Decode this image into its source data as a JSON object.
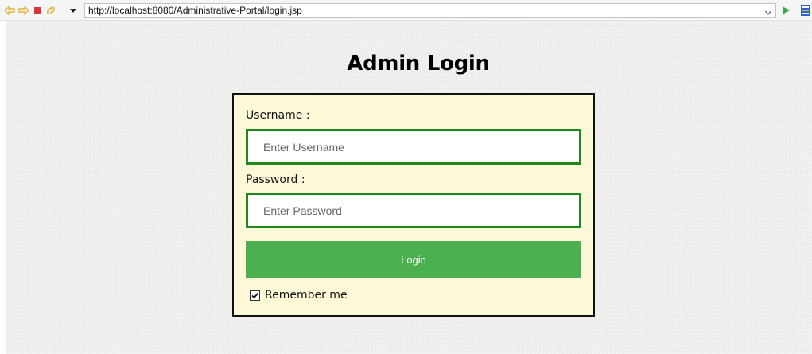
{
  "browser": {
    "url": "http://localhost:8080/Administrative-Portal/login.jsp",
    "icons": [
      "back-arrow-icon",
      "forward-arrow-icon",
      "stop-icon",
      "refresh-icon",
      "chevron-down-icon",
      "go-icon",
      "sidebar-icon"
    ],
    "colors": {
      "nav_arrow": "#e8b33a",
      "stop": "#d9323a",
      "go": "#3aa84a"
    }
  },
  "page": {
    "title": "Admin Login",
    "username_label": "Username :",
    "username_placeholder": "Enter Username",
    "username_value": "",
    "password_label": "Password :",
    "password_placeholder": "Enter Password",
    "password_value": "",
    "login_button": "Login",
    "remember_label": "Remember me",
    "remember_checked": true
  },
  "colors": {
    "box_background": "#fdf8d8",
    "field_border": "#1e8a1e",
    "button_background": "#4caf50",
    "page_background": "#efeeec"
  }
}
